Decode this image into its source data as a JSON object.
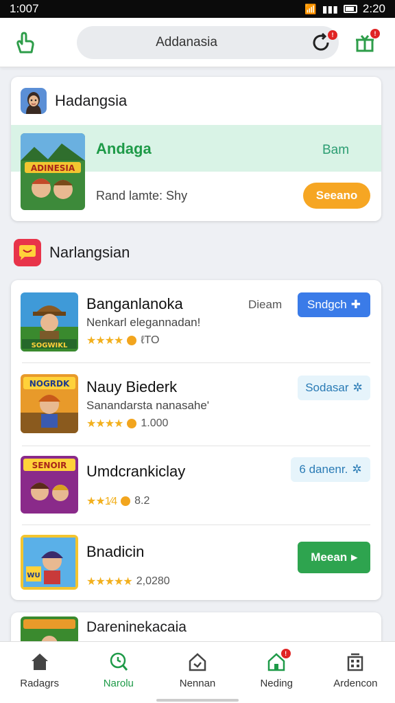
{
  "status_bar": {
    "time_left": "1:007",
    "time_right": "2:20"
  },
  "header": {
    "search_text": "Addanasia",
    "refresh_badge": "!",
    "gift_badge": "!"
  },
  "featured": {
    "heading": "Hadangsia",
    "title": "Andaga",
    "link": "Bam",
    "subtitle": "Rand lamte: Shy",
    "button": "Seeano",
    "thumb_text": "ADINESIA"
  },
  "section2": {
    "heading": "Narlangsian"
  },
  "games": [
    {
      "name": "Banganlanoka",
      "desc": "Nenkarl elegannadan!",
      "rating_text": "ℓTO",
      "stars": "★★★★",
      "tag": "Dieam",
      "button": "Sndgch",
      "button_icon": "✚",
      "button_style": "blue",
      "thumb_text": "SOGWIKL"
    },
    {
      "name": "Nauy Biederk",
      "desc": "Sanandarsta nanasahe'",
      "rating_text": "1.000",
      "stars": "★★★★",
      "tag": "",
      "button": "Sodasar",
      "button_icon": "✲",
      "button_style": "light",
      "thumb_text": "NOGRDK"
    },
    {
      "name": "Umdcrankiclay",
      "desc": "",
      "rating_text": "8.2",
      "stars": "★★1⁄4",
      "tag": "",
      "button": "6 danenr.",
      "button_icon": "✲",
      "button_style": "light",
      "thumb_text": "SENOIR"
    },
    {
      "name": "Bnadicin",
      "desc": "",
      "rating_text": "2,0280",
      "stars": "★★★★★",
      "tag": "",
      "button": "Meean",
      "button_icon": "▸",
      "button_style": "green",
      "thumb_text": "WU"
    }
  ],
  "partial_item": {
    "name": "Dareninekacaia"
  },
  "bottom_nav": [
    {
      "label": "Radagrs",
      "icon": "home-icon",
      "active": false
    },
    {
      "label": "Narolu",
      "icon": "search-clock-icon",
      "active": true
    },
    {
      "label": "Nennan",
      "icon": "house-outline-icon",
      "active": false
    },
    {
      "label": "Neding",
      "icon": "house-badge-icon",
      "active": false
    },
    {
      "label": "Ardencon",
      "icon": "building-icon",
      "active": false
    }
  ],
  "colors": {
    "accent_green": "#1e9a48",
    "orange": "#f6a623",
    "blue": "#3a7be8"
  }
}
